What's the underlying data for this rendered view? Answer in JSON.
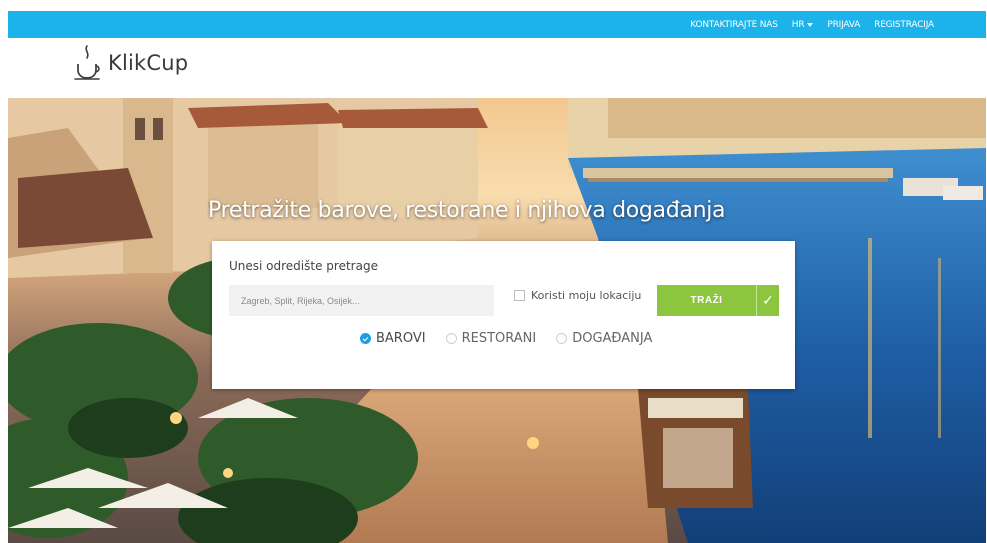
{
  "topbar": {
    "contact": "KONTAKTIRAJTE NAS",
    "language": "HR",
    "login": "PRIJAVA",
    "register": "REGISTRACIJA"
  },
  "brand": {
    "name": "KlikCup",
    "logo_icon": "coffee-cup-icon"
  },
  "hero": {
    "title": "Pretražite barove, restorane i njihova događanja"
  },
  "search": {
    "label": "Unesi odredište pretrage",
    "placeholder": "Zagreb, Split, Rijeka, Osijek...",
    "value": "",
    "use_location_label": "Koristi moju lokaciju",
    "use_location_checked": false,
    "button_label": "TRAŽI",
    "button_icon": "checkmark-icon",
    "types": [
      {
        "label": "BAROVI",
        "selected": true
      },
      {
        "label": "RESTORANI",
        "selected": false
      },
      {
        "label": "DOGAĐANJA",
        "selected": false
      }
    ]
  },
  "colors": {
    "topbar": "#1cb3ea",
    "button": "#8cc63f",
    "radio_selected": "#1e9ee0"
  }
}
